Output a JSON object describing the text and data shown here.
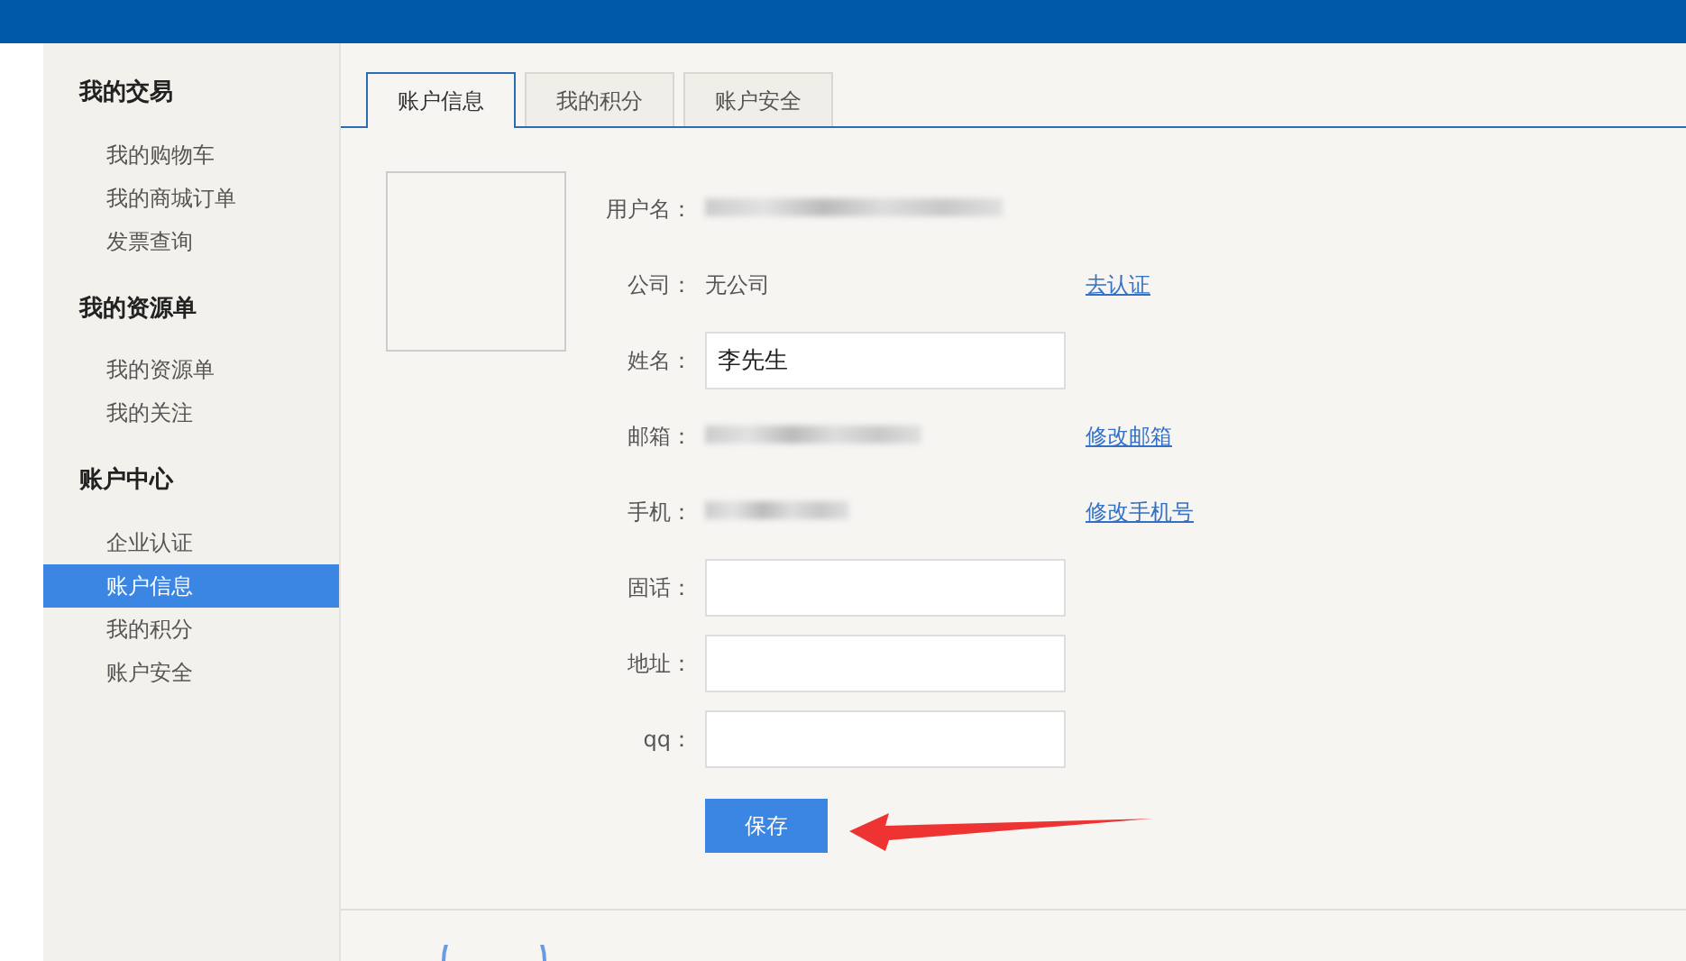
{
  "sidebar": {
    "groups": [
      {
        "title": "我的交易",
        "items": [
          {
            "label": "我的购物车",
            "selected": false
          },
          {
            "label": "我的商城订单",
            "selected": false
          },
          {
            "label": "发票查询",
            "selected": false
          }
        ]
      },
      {
        "title": "我的资源单",
        "items": [
          {
            "label": "我的资源单",
            "selected": false
          },
          {
            "label": "我的关注",
            "selected": false
          }
        ]
      },
      {
        "title": "账户中心",
        "items": [
          {
            "label": "企业认证",
            "selected": false
          },
          {
            "label": "账户信息",
            "selected": true
          },
          {
            "label": "我的积分",
            "selected": false
          },
          {
            "label": "账户安全",
            "selected": false
          }
        ]
      }
    ]
  },
  "tabs": [
    {
      "label": "账户信息",
      "selected": true
    },
    {
      "label": "我的积分",
      "selected": false
    },
    {
      "label": "账户安全",
      "selected": false
    }
  ],
  "form": {
    "rows": [
      {
        "kind": "redacted",
        "label": "用户名："
      },
      {
        "kind": "text",
        "label": "公司：",
        "value": "无公司",
        "link": "去认证"
      },
      {
        "kind": "input",
        "label": "姓名：",
        "value": "李先生"
      },
      {
        "kind": "redacted",
        "label": "邮箱：",
        "link": "修改邮箱"
      },
      {
        "kind": "redacted",
        "label": "手机：",
        "link": "修改手机号"
      },
      {
        "kind": "input",
        "label": "固话："
      },
      {
        "kind": "input",
        "label": "地址："
      },
      {
        "kind": "input",
        "label": "qq："
      }
    ],
    "save_button": "保存"
  }
}
